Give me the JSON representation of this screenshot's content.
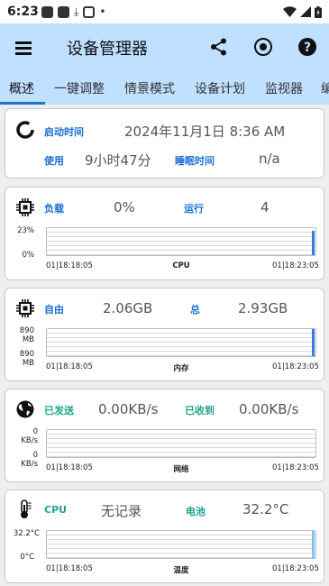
{
  "status_bar": {
    "time": "6:23",
    "dot": "•"
  },
  "app_bar": {
    "title": "设备管理器",
    "menu_icon": "hamburger-menu-icon",
    "icons": [
      "share-icon",
      "record-icon",
      "help-icon"
    ]
  },
  "tabs": [
    "概述",
    "一键调整",
    "情景模式",
    "设备计划",
    "监视器",
    "编"
  ],
  "uptime_card": {
    "start_label": "启动时间",
    "start_value": "2024年11月1日 8:36 AM",
    "use_label": "使用",
    "use_value": "9小时47分",
    "sleep_label": "睡眠时间",
    "sleep_value": "n/a"
  },
  "cpu_card": {
    "load_label": "负载",
    "load_value": "0%",
    "run_label": "运行",
    "run_value": "4",
    "y_top": "23%",
    "y_bottom": "0%",
    "t_start": "01|18:18:05",
    "graph_label": "CPU",
    "t_end": "01|18:23:05",
    "last_level": 0.9
  },
  "mem_card": {
    "free_label": "自由",
    "free_value": "2.06GB",
    "total_label": "总",
    "total_value": "2.93GB",
    "y_top_1": "890",
    "y_top_2": "MB",
    "y_bottom_1": "890",
    "y_bottom_2": "MB",
    "t_start": "01|18:18:05",
    "graph_label": "内存",
    "t_end": "01|18:23:05",
    "last_level": 1.0
  },
  "net_card": {
    "sent_label": "已发送",
    "sent_value": "0.00KB/s",
    "recv_label": "已收到",
    "recv_value": "0.00KB/s",
    "y_top_1": "0",
    "y_top_2": "KB/s",
    "y_bottom_1": "0",
    "y_bottom_2": "KB/s",
    "t_start": "01|18:18:05",
    "graph_label": "网络",
    "t_end": "01|18:23:05",
    "last_level": 0
  },
  "temp_card": {
    "cpu_label": "CPU",
    "cpu_value": "无记录",
    "battery_label": "电池",
    "battery_value": "32.2°C",
    "y_top": "32.2°C",
    "y_bottom": "0°C",
    "t_start": "01|18:18:05",
    "graph_label": "温度",
    "t_end": "01|18:23:05",
    "last_level": 1.0
  },
  "colors": {
    "app_bar": "#bfe0ff",
    "accent": "#1a6fd4",
    "label_green": "#1aa58a",
    "graph_bar": "#2f7de1"
  }
}
